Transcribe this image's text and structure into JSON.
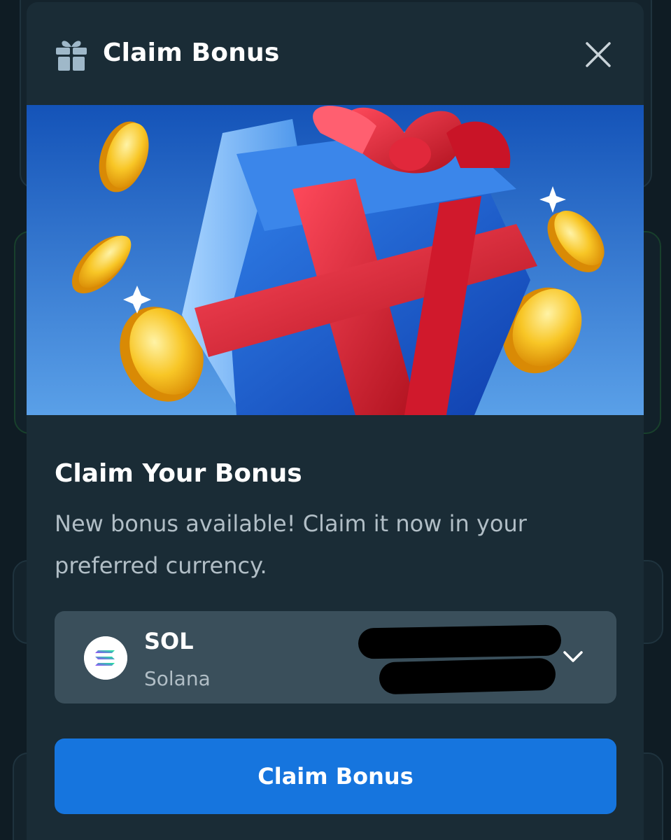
{
  "modal": {
    "title": "Claim Bonus",
    "header_icon": "gift-icon",
    "close_icon": "close-icon"
  },
  "banner": {
    "description_icon": "gift-box-with-coins-illustration"
  },
  "content": {
    "title": "Claim Your Bonus",
    "description": "New bonus available! Claim it now in your preferred currency."
  },
  "currency": {
    "code": "SOL",
    "name": "Solana",
    "icon": "solana-logo-icon",
    "dropdown_icon": "chevron-down-icon"
  },
  "action": {
    "claim_label": "Claim Bonus"
  },
  "colors": {
    "modal_bg": "#1a2c36",
    "select_bg": "#3a4f5b",
    "accent": "#1675de",
    "banner_bg": "#1e66c6",
    "ribbon": "#e8253a",
    "coin": "#f5b60e"
  }
}
